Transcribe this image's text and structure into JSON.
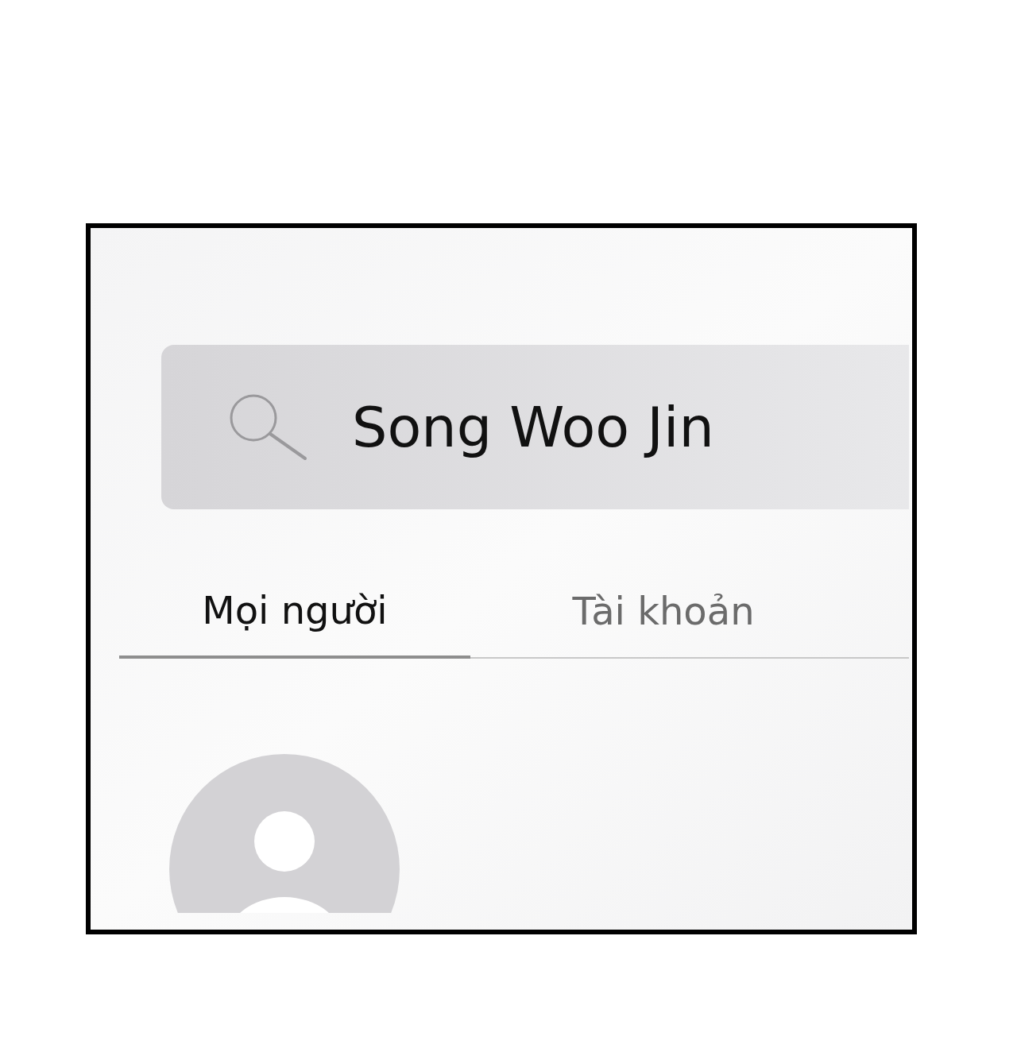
{
  "search": {
    "value": "Song Woo Jin"
  },
  "tabs": [
    {
      "label": "Mọi người",
      "selected": true
    },
    {
      "label": "Tài khoản",
      "selected": false
    }
  ]
}
